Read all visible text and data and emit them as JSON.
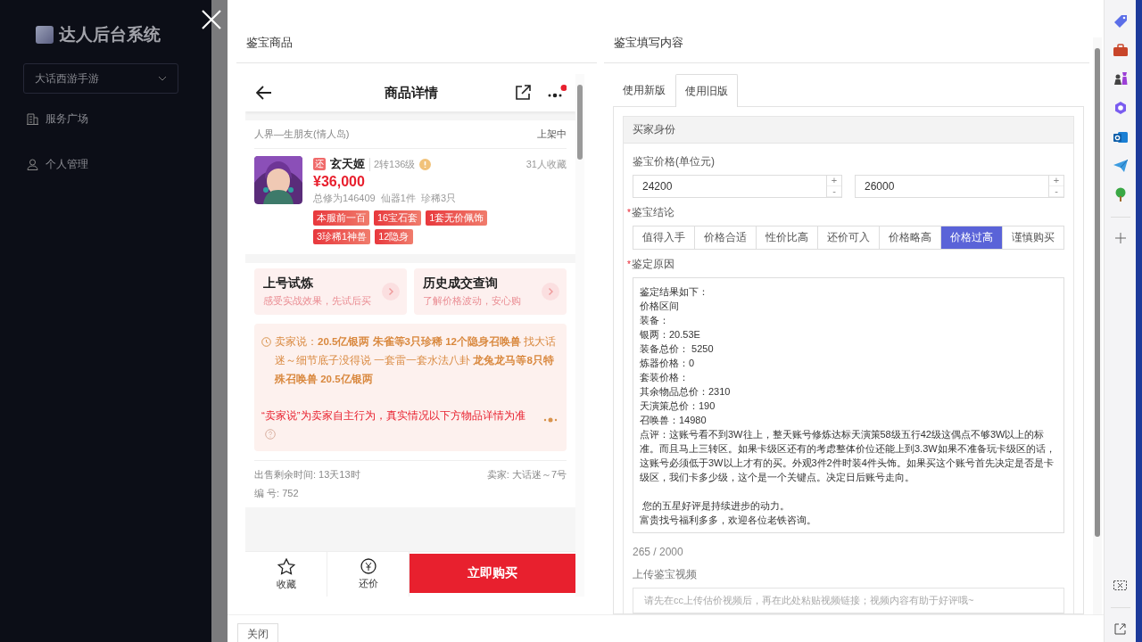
{
  "sidebar": {
    "logo_text": "达人后台系统",
    "game_select": "大话西游手游",
    "items": [
      {
        "label": "服务广场",
        "kind": "building"
      },
      {
        "label": "个人管理",
        "kind": "person"
      }
    ]
  },
  "drawer": {
    "left_title": "鉴宝商品",
    "right_title": "鉴宝填写内容",
    "close_button": "关闭"
  },
  "product": {
    "header_title": "商品详情",
    "notification": true,
    "server": "人界—生朋友(情人岛)",
    "status": "上架中",
    "badge": "还",
    "name": "玄天姬",
    "level_text": "2转136级",
    "favorites": "31人收藏",
    "price": "¥36,000",
    "stats": "总修为146409  仙器1件  珍稀3只",
    "tags": [
      "本服前一百",
      "16宝石套",
      "1套无价佩饰",
      "3珍稀1神兽",
      "12隐身"
    ],
    "promos": [
      {
        "title": "上号试炼",
        "subtitle": "感受实战效果，先试后买"
      },
      {
        "title": "历史成交查询",
        "subtitle": "了解价格波动，安心购"
      }
    ],
    "seller_note": "卖家说：**20.5亿银两 朱雀等3只珍稀 12个隐身召唤兽** 找大话迷～细节底子没得说 一套雷一套水法八卦 **龙兔龙马等8只特殊召唤兽 20.5亿银两**",
    "disclaimer": "“卖家说”为卖家自主行为，真实情况以下方物品详情为准",
    "sale_time": "出售剩余时间: 13天13时",
    "seller": "卖家: 大话迷～7号",
    "number": "编 号: 752",
    "actions": [
      {
        "label": "收藏",
        "kind": "star"
      },
      {
        "label": "还价",
        "kind": "coin"
      }
    ],
    "buy_button": "立即购买"
  },
  "form": {
    "tabs": [
      {
        "label": "使用新版",
        "selected": false
      },
      {
        "label": "使用旧版",
        "selected": true
      }
    ],
    "section_title": "买家身份",
    "price_label": {
      "text": "鉴宝价格(单位元)"
    },
    "price_fields": [
      {
        "value": "24200",
        "increment": "+",
        "decrement": "-"
      },
      {
        "value": "26000",
        "increment": "+",
        "decrement": "-"
      }
    ],
    "conclusion_label": {
      "text": "鉴宝结论",
      "required_mark": "*"
    },
    "conclusions": [
      {
        "label": "值得入手",
        "selected": false
      },
      {
        "label": "价格合适",
        "selected": false
      },
      {
        "label": "性价比高",
        "selected": false
      },
      {
        "label": "还价可入",
        "selected": false
      },
      {
        "label": "价格略高",
        "selected": false
      },
      {
        "label": "价格过高",
        "selected": true
      },
      {
        "label": "谨慎购买",
        "selected": false
      }
    ],
    "reason_label": {
      "text": "鉴定原因",
      "required_mark": "*"
    },
    "reason_lines": [
      {
        "text": "鉴定结果如下：",
        "gap_before": false
      },
      {
        "text": "价格区间",
        "gap_before": false
      },
      {
        "text": "装备：",
        "gap_before": false
      },
      {
        "text": "银两：20.53E",
        "gap_before": false
      },
      {
        "text": "装备总价： 5250",
        "gap_before": false
      },
      {
        "text": "炼器价格：0",
        "gap_before": false
      },
      {
        "text": "套装价格：",
        "gap_before": false
      },
      {
        "text": "其余物品总价：2310",
        "gap_before": false
      },
      {
        "text": "天演策总价：190",
        "gap_before": false
      },
      {
        "text": "召唤兽：14980",
        "gap_before": false
      },
      {
        "text": "点评：这账号看不到3W往上，整天账号修炼达标天演策58级五行42级这偶点不够3W以上的标准。而且马上三转区。如果卡级区还有的考虑整体价位还能上到3.3W如果不准备玩卡级区的话，这账号必须低于3W以上才有的买。外观3件2件时装4件头饰。如果买这个账号首先决定是否是卡级区，我们卡多少级，这个是一个关键点。决定日后账号走向。",
        "gap_before": false
      },
      {
        "text": "您的五星好评是持续进步的动力。",
        "gap_before": true
      },
      {
        "text": "富贵找号福利多多，欢迎各位老铁咨询。",
        "gap_before": false
      }
    ],
    "counter": "265 / 2000",
    "video_label": "上传鉴宝视频",
    "video_placeholder": "请先在cc上传估价视频后，再在此处粘贴视频链接；视频内容有助于好评哦~"
  }
}
